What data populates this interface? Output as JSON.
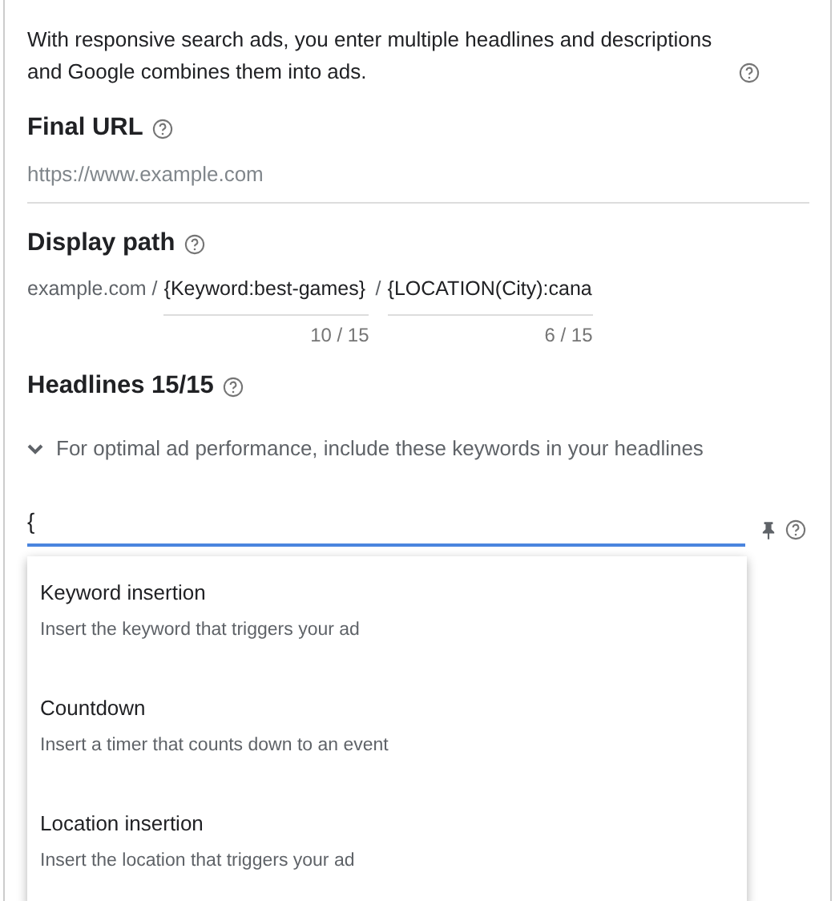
{
  "intro": "With responsive search ads, you enter multiple headlines and descriptions and Google combines them into ads.",
  "final_url": {
    "label": "Final URL",
    "placeholder": "https://www.example.com"
  },
  "display_path": {
    "label": "Display path",
    "domain": "example.com /",
    "separator": "/",
    "fields": [
      {
        "value": "{Keyword:best-games}",
        "counter": "10 / 15"
      },
      {
        "value": "{LOCATION(City):cana",
        "counter": "6 / 15"
      }
    ]
  },
  "headlines": {
    "label": "Headlines 15/15",
    "hint": "For optimal ad performance, include these keywords in your headlines",
    "expanded": false,
    "value": "{"
  },
  "dropdown": [
    {
      "title": "Keyword insertion",
      "description": "Insert the keyword that triggers your ad"
    },
    {
      "title": "Countdown",
      "description": "Insert a timer that counts down to an event"
    },
    {
      "title": "Location insertion",
      "description": "Insert the location that triggers your ad"
    }
  ]
}
